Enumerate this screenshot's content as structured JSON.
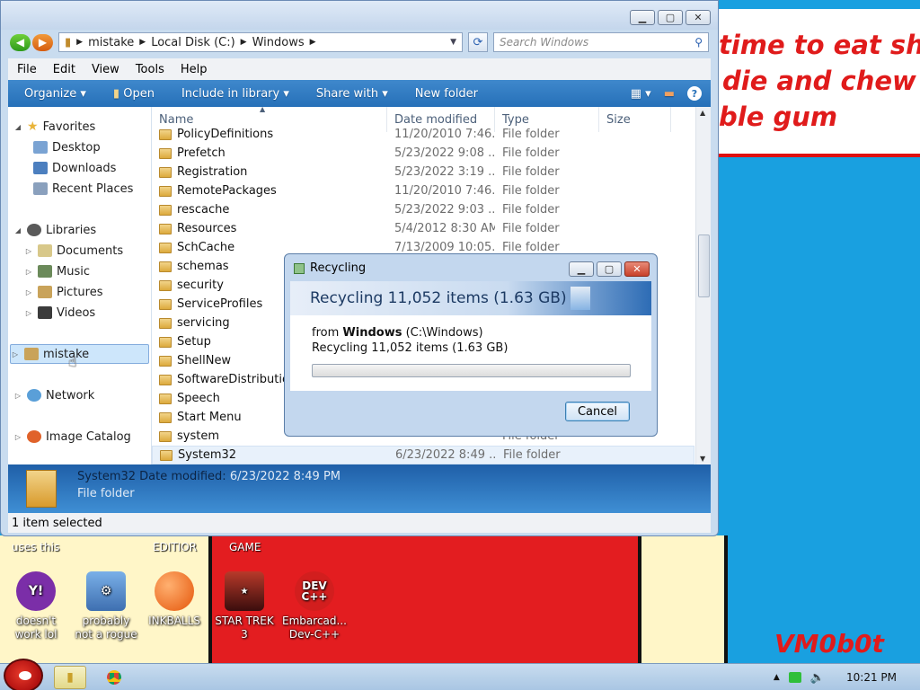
{
  "window": {
    "address": [
      "mistake",
      "Local Disk (C:)",
      "Windows"
    ],
    "search_placeholder": "Search Windows",
    "menu": [
      "File",
      "Edit",
      "View",
      "Tools",
      "Help"
    ],
    "toolbar": {
      "organize": "Organize",
      "open": "Open",
      "include_in_library": "Include in library",
      "share_with": "Share with",
      "new_folder": "New folder"
    },
    "nav": {
      "favorites": "Favorites",
      "desktop": "Desktop",
      "downloads": "Downloads",
      "recent_places": "Recent Places",
      "libraries": "Libraries",
      "documents": "Documents",
      "music": "Music",
      "pictures": "Pictures",
      "videos": "Videos",
      "mistake": "mistake",
      "network": "Network",
      "image_catalog": "Image Catalog"
    },
    "columns": {
      "name": "Name",
      "date_modified": "Date modified",
      "type": "Type",
      "size": "Size"
    },
    "files": [
      {
        "name": "PolicyDefinitions",
        "date": "11/20/2010 7:46...",
        "type": "File folder"
      },
      {
        "name": "Prefetch",
        "date": "5/23/2022 9:08 ...",
        "type": "File folder"
      },
      {
        "name": "Registration",
        "date": "5/23/2022 3:19 ...",
        "type": "File folder"
      },
      {
        "name": "RemotePackages",
        "date": "11/20/2010 7:46...",
        "type": "File folder"
      },
      {
        "name": "rescache",
        "date": "5/23/2022 9:03 ...",
        "type": "File folder"
      },
      {
        "name": "Resources",
        "date": "5/4/2012 8:30 AM",
        "type": "File folder"
      },
      {
        "name": "SchCache",
        "date": "7/13/2009 10:05...",
        "type": "File folder"
      },
      {
        "name": "schemas",
        "date": "",
        "type": ""
      },
      {
        "name": "security",
        "date": "",
        "type": ""
      },
      {
        "name": "ServiceProfiles",
        "date": "",
        "type": ""
      },
      {
        "name": "servicing",
        "date": "",
        "type": ""
      },
      {
        "name": "Setup",
        "date": "",
        "type": ""
      },
      {
        "name": "ShellNew",
        "date": "",
        "type": ""
      },
      {
        "name": "SoftwareDistributio",
        "date": "",
        "type": ""
      },
      {
        "name": "Speech",
        "date": "",
        "type": ""
      },
      {
        "name": "Start Menu",
        "date": "",
        "type": ""
      },
      {
        "name": "system",
        "date": "",
        "type": "File folder"
      },
      {
        "name": "System32",
        "date": "6/23/2022 8:49 ...",
        "type": "File folder"
      }
    ],
    "details": {
      "name": "System32",
      "date_label": "Date modified:",
      "date_value": "6/23/2022 8:49 PM",
      "type": "File folder"
    },
    "status": "1 item selected"
  },
  "dialog": {
    "title": "Recycling",
    "heading": "Recycling 11,052 items (1.63 GB)",
    "from_prefix": "from",
    "from_bold": "Windows",
    "from_path": "(C:\\Windows)",
    "sub": "Recycling 11,052 items (1.63 GB)",
    "progress": 0.0,
    "cancel": "Cancel"
  },
  "wallpaper": {
    "lines": [
      "time to eat shit",
      "die and chew",
      "ble gum"
    ],
    "labels": [
      "uses this",
      "EDITIOR",
      "GAME"
    ],
    "signature": "VM0b0t"
  },
  "desktop_icons": [
    {
      "label": "doesn't work lol",
      "icon": "yahoo-messenger-icon",
      "color": "#7b2ea8"
    },
    {
      "label": "probably not a rogue",
      "icon": "gears-computer-icon",
      "color": "#4a7fc4"
    },
    {
      "label": "INKBALLS",
      "icon": "inkball-icon",
      "color": "#ef6d14"
    },
    {
      "label": "STAR TREK 3",
      "icon": "star-wars-game-icon",
      "color": "#7a1f1f"
    },
    {
      "label": "Embarcad... Dev-C++",
      "icon": "dev-cpp-icon",
      "color": "#d21e1e"
    }
  ],
  "taskbar": {
    "clock": "10:21 PM"
  }
}
